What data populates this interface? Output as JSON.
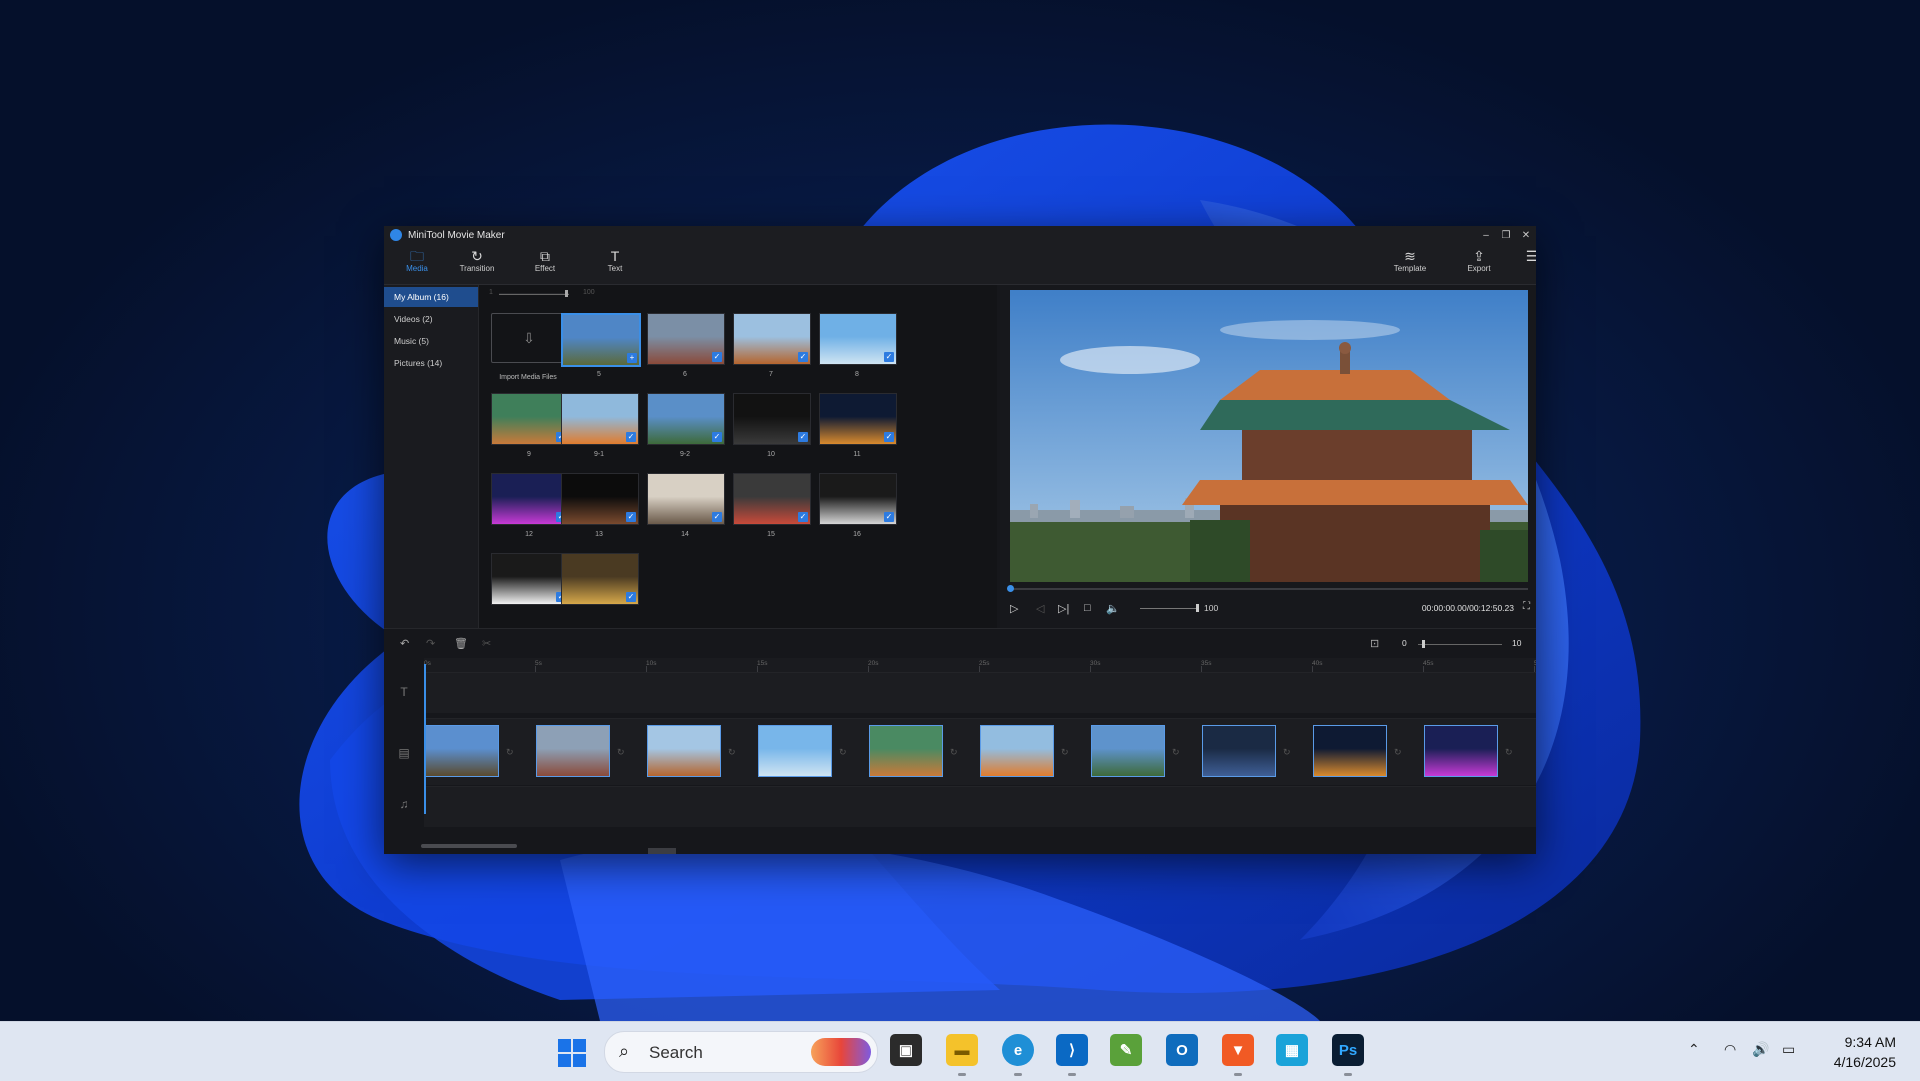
{
  "window": {
    "title": "MiniTool Movie Maker",
    "controls": [
      "–",
      "❐",
      "✕"
    ]
  },
  "toolbar": {
    "media": "Media",
    "transition": "Transition",
    "effect": "Effect",
    "text": "Text",
    "template": "Template",
    "export": "Export"
  },
  "sidebar": {
    "items": [
      {
        "label": "My Album (16)"
      },
      {
        "label": "Videos (2)"
      },
      {
        "label": "Music (5)"
      },
      {
        "label": "Pictures (14)"
      }
    ]
  },
  "library": {
    "zoom_min": "1",
    "zoom_max": "100",
    "import_label": "Import Media Files",
    "items": [
      {
        "label": "5"
      },
      {
        "label": "6"
      },
      {
        "label": "7"
      },
      {
        "label": "8"
      },
      {
        "label": "9"
      },
      {
        "label": "9-1"
      },
      {
        "label": "9-2"
      },
      {
        "label": "10"
      },
      {
        "label": "11"
      },
      {
        "label": "12"
      },
      {
        "label": "13"
      },
      {
        "label": "14"
      },
      {
        "label": "15"
      },
      {
        "label": "16"
      },
      {
        "label": ""
      },
      {
        "label": ""
      }
    ]
  },
  "player": {
    "volume": "100",
    "timecode": "00:00:00.00/00:12:50.23"
  },
  "timeline": {
    "zoom_min": "0",
    "zoom_max": "10",
    "ruler": [
      "0s",
      "5s",
      "10s",
      "15s",
      "20s",
      "25s",
      "30s",
      "35s",
      "40s",
      "45s",
      "50"
    ]
  },
  "taskbar": {
    "search_placeholder": "Search",
    "time": "9:34 AM",
    "date": "4/16/2025"
  },
  "colors": {
    "accent": "#3a8fe8",
    "window_bg": "#16171b"
  }
}
